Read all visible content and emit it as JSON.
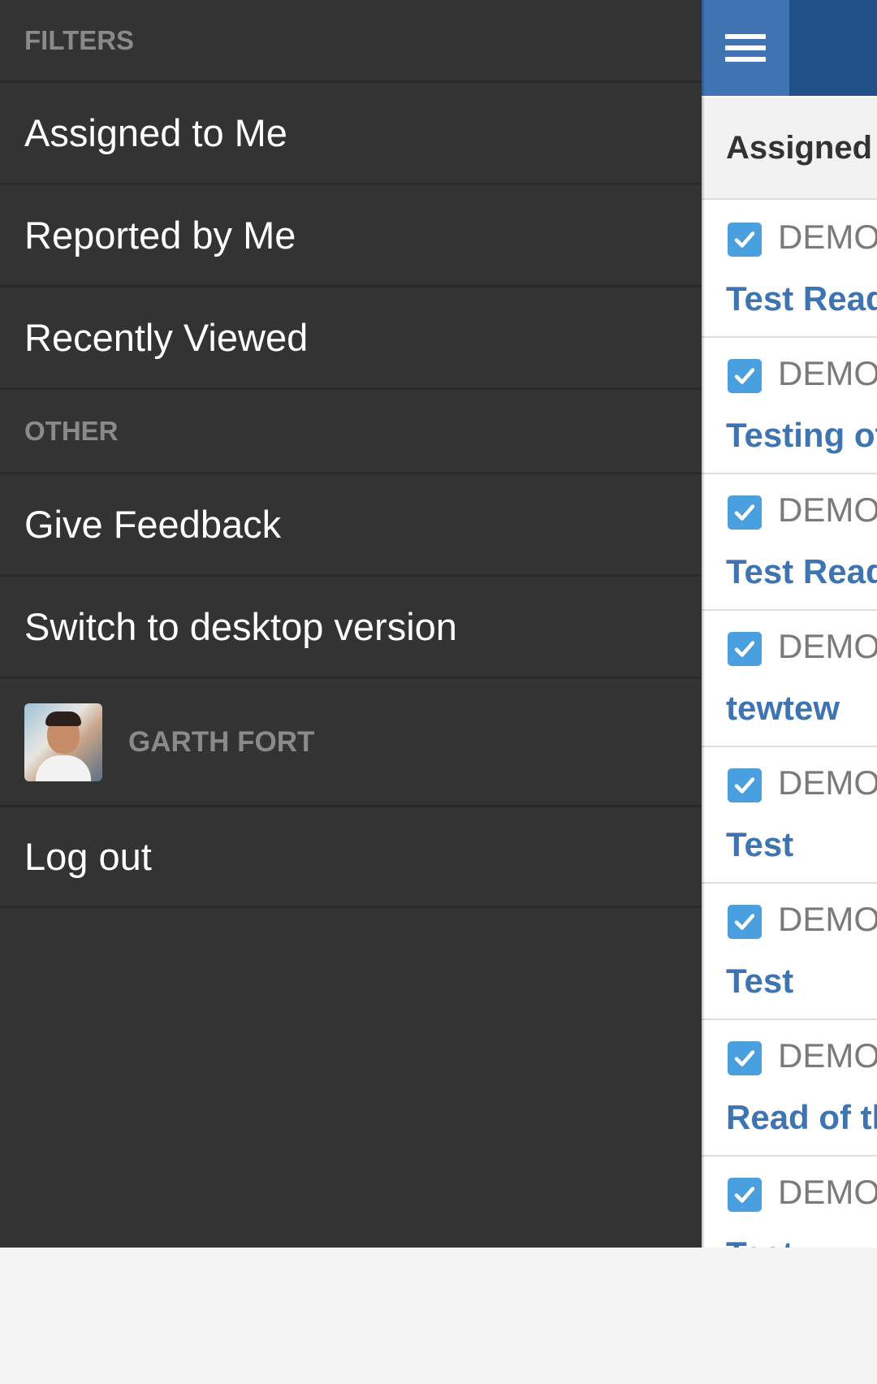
{
  "drawer": {
    "filters_header": "FILTERS",
    "filters": [
      {
        "label": "Assigned to Me"
      },
      {
        "label": "Reported by Me"
      },
      {
        "label": "Recently Viewed"
      }
    ],
    "other_header": "OTHER",
    "other": [
      {
        "label": "Give Feedback"
      },
      {
        "label": "Switch to desktop version"
      }
    ],
    "user": {
      "name": "GARTH FORT"
    },
    "logout_label": "Log out"
  },
  "main": {
    "menu_icon": "hamburger-menu-icon",
    "list_title": "Assigned",
    "issues": [
      {
        "key": "DEMO-",
        "summary": "Test Read",
        "icon": "checkbox-checked-icon"
      },
      {
        "key": "DEMO-",
        "summary": "Testing of",
        "icon": "checkbox-checked-icon"
      },
      {
        "key": "DEMO-",
        "summary": "Test Read",
        "icon": "checkbox-checked-icon"
      },
      {
        "key": "DEMO-",
        "summary": "tewtew",
        "icon": "checkbox-checked-icon"
      },
      {
        "key": "DEMO-",
        "summary": "Test",
        "icon": "checkbox-checked-icon"
      },
      {
        "key": "DEMO-",
        "summary": "Test",
        "icon": "checkbox-checked-icon"
      },
      {
        "key": "DEMO-",
        "summary": "Read of th",
        "icon": "checkbox-checked-icon"
      },
      {
        "key": "DEMO-",
        "summary": "Test",
        "icon": "checkbox-checked-icon"
      }
    ]
  },
  "colors": {
    "drawer_bg": "#333333",
    "topbar_bg": "#1e4f86",
    "menu_button_bg": "#3d74b1",
    "link_blue": "#3d74b1",
    "checkbox_blue": "#4a9fdf"
  }
}
